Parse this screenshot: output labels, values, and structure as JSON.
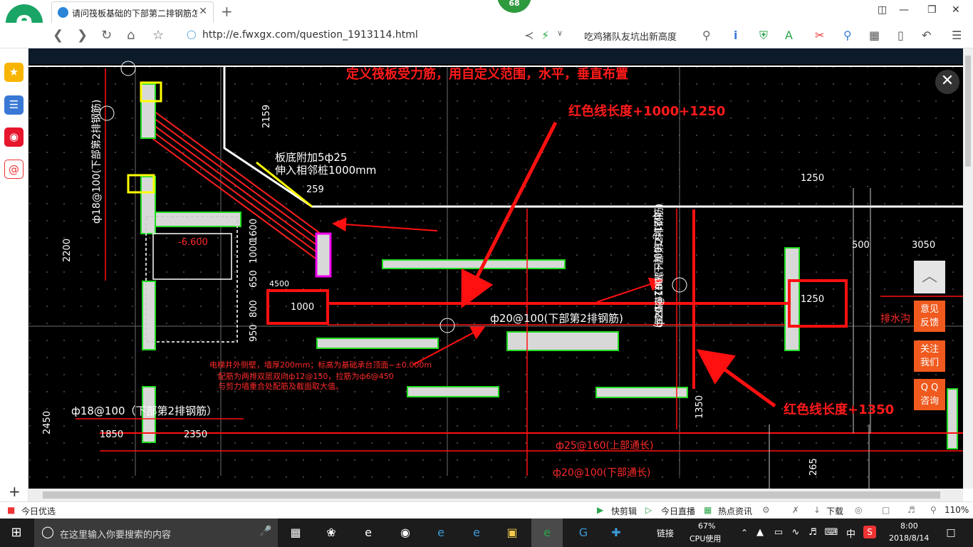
{
  "browser": {
    "logo_char": "e",
    "tab_title": "请问筏板基础的下部第二排钢筋怎",
    "tab_close": "✕",
    "new_tab": "+",
    "badge": "68",
    "url": "http://e.fwxgx.com/question_1913114.html",
    "search_text": "吃鸡猪队友坑出新高度",
    "ext_badge": "8"
  },
  "sidebar": {
    "items": [
      {
        "name": "favorites",
        "icon": "star-icon",
        "color": "#f7b500"
      },
      {
        "name": "reader",
        "icon": "list-icon",
        "color": "#3a78d6"
      },
      {
        "name": "weibo",
        "icon": "weibo-icon",
        "color": "#e6162d"
      },
      {
        "name": "mail",
        "icon": "at-icon",
        "color": "#ffffff"
      }
    ],
    "add": "+"
  },
  "drawing": {
    "heading": "定义筏板受力筋，用自定义范围，水平，垂直布置",
    "note_1": "红色线长度+1000+1250",
    "note_2": "红色线长度+1350",
    "label_bottom_add": "板底附加5ф25",
    "label_extend": "伸入相邻桩1000mm",
    "dim_2159": "2159",
    "dim_259": "259",
    "dim_1250_top": "1250",
    "dim_3050": "3050",
    "dim_500": "500",
    "dim_1250_box": "1250",
    "dim_1000": "1000",
    "elev_6600": "-6.600",
    "dim_1600": "1600",
    "dim_1000v": "1000",
    "dim_650": "650",
    "dim_4500": "4500",
    "dim_800": "800",
    "dim_950": "950",
    "dim_2200": "2200",
    "dim_2450": "2450",
    "dim_1850": "1850",
    "dim_2350": "2350",
    "dim_1350": "1350",
    "dim_265": "265",
    "rebar_main": "ф20@100(下部第2排钢筋)",
    "rebar_left": "ф18@100（下部第2排钢筋）",
    "rebar_left_vert": "ф18@100(下部第2排钢筋)",
    "rebar_right_vert1": "ф20@100(下部第2排钢筋)",
    "rebar_right_vert2": "ф21@100(下部第2排钢筋)",
    "rebar_top_through": "ф25@160(上部通长)",
    "rebar_bottom_through": "ф20@100(下部通长)",
    "drain": "排水沟",
    "small_note_1": "电梯井外侧壁，墙厚200mm；标高为基础承台顶面~±0.000m",
    "small_note_2": "配筋为两排双层双向ф12@150，拉筋为ф6@450",
    "small_note_3": "与剪力墙重合处配筋及截面取大值。"
  },
  "overlay": {
    "close": "✕",
    "to_top": "︿",
    "feedback": "意见\n反馈",
    "follow": "关注\n我们",
    "qq": "Q Q\n咨询"
  },
  "statusbar": {
    "today": "今日优选",
    "quick_clip": "快剪辑",
    "live": "今日直播",
    "news": "热点资讯",
    "download": "下载",
    "zoom": "110%"
  },
  "taskbar": {
    "search_placeholder": "在这里输入你要搜索的内容",
    "link": "链接",
    "cpu_percent": "67%",
    "cpu_label": "CPU使用",
    "ime": "中",
    "time": "8:00",
    "date": "2018/8/14"
  }
}
